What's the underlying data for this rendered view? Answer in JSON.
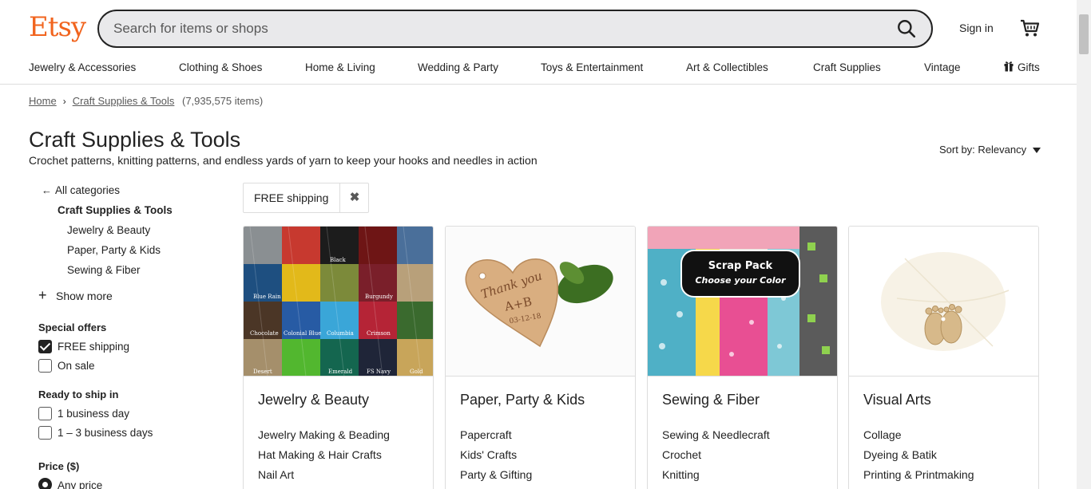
{
  "header": {
    "logo": "Etsy",
    "search_placeholder": "Search for items or shops",
    "sign_in": "Sign in"
  },
  "nav": [
    "Jewelry & Accessories",
    "Clothing & Shoes",
    "Home & Living",
    "Wedding & Party",
    "Toys & Entertainment",
    "Art & Collectibles",
    "Craft Supplies",
    "Vintage",
    "Gifts"
  ],
  "breadcrumb": {
    "home": "Home",
    "current": "Craft Supplies & Tools",
    "count": "(7,935,575 items)"
  },
  "page": {
    "title": "Craft Supplies & Tools",
    "subtitle": "Crochet patterns, knitting patterns, and endless yards of yarn to keep your hooks and needles in action",
    "sort": "Sort by: Relevancy"
  },
  "sidebar": {
    "all_categories": "All categories",
    "current_category": "Craft Supplies & Tools",
    "subcategories": [
      "Jewelry & Beauty",
      "Paper, Party & Kids",
      "Sewing & Fiber"
    ],
    "show_more": "Show more",
    "special_offers": {
      "heading": "Special offers",
      "options": [
        {
          "label": "FREE shipping",
          "checked": true
        },
        {
          "label": "On sale",
          "checked": false
        }
      ]
    },
    "ready_to_ship": {
      "heading": "Ready to ship in",
      "options": [
        {
          "label": "1 business day",
          "checked": false
        },
        {
          "label": "1 – 3 business days",
          "checked": false
        }
      ]
    },
    "price": {
      "heading": "Price ($)",
      "selected": "Any price"
    }
  },
  "filter_chip": {
    "label": "FREE shipping"
  },
  "cards": [
    {
      "title": "Jewelry & Beauty",
      "links": [
        "Jewelry Making & Beading",
        "Hat Making & Hair Crafts",
        "Nail Art"
      ],
      "image_labels": [
        "Black",
        "Blue Rain",
        "Burgundy",
        "Chocolate",
        "Colonial Blue",
        "Columbia",
        "Crimson",
        "Desert",
        "Emerald",
        "FS Navy",
        "Gold"
      ]
    },
    {
      "title": "Paper, Party & Kids",
      "links": [
        "Papercraft",
        "Kids' Crafts",
        "Party & Gifting"
      ],
      "image_text": {
        "line1": "Thank you",
        "line2": "A+B",
        "line3": "03-12-18"
      }
    },
    {
      "title": "Sewing & Fiber",
      "links": [
        "Sewing & Needlecraft",
        "Crochet",
        "Knitting"
      ],
      "image_text": {
        "line1": "Scrap Pack",
        "line2": "Choose your Color"
      }
    },
    {
      "title": "Visual Arts",
      "links": [
        "Collage",
        "Dyeing & Batik",
        "Printing & Printmaking"
      ]
    }
  ],
  "colors": {
    "brand": "#F1641E",
    "text": "#222222",
    "border": "#dddddd",
    "search_bg": "#e9e9eb"
  }
}
